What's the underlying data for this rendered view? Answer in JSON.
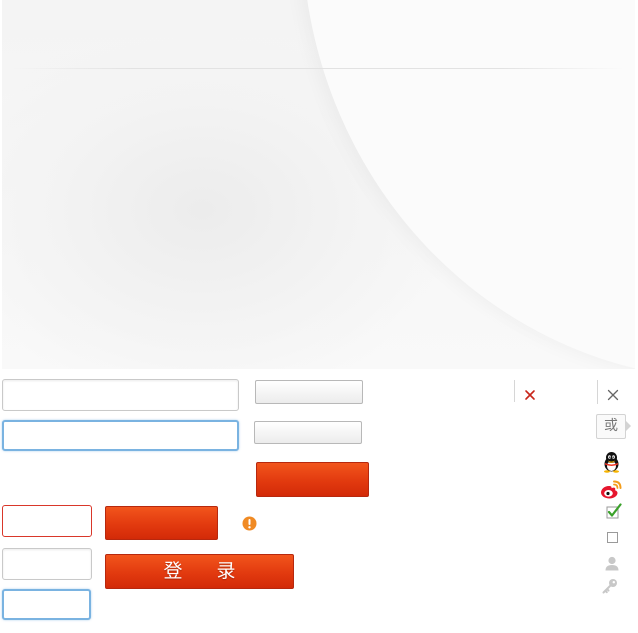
{
  "login": {
    "submit_label": "登 录"
  },
  "separator": {
    "or_label": "或"
  },
  "icons": {
    "close_red": "close-icon",
    "close_gray": "close-icon",
    "warning": "warning-icon",
    "qq": "qq-icon",
    "weibo": "weibo-icon",
    "checkbox_checked": "checkbox-checked-icon",
    "checkbox_empty": "checkbox-icon",
    "user": "user-icon",
    "key": "key-icon"
  },
  "colors": {
    "accent_red": "#e23a0f",
    "focus_blue": "#7ab3e1",
    "error_red": "#d9372a",
    "warning_orange": "#f08a24"
  }
}
